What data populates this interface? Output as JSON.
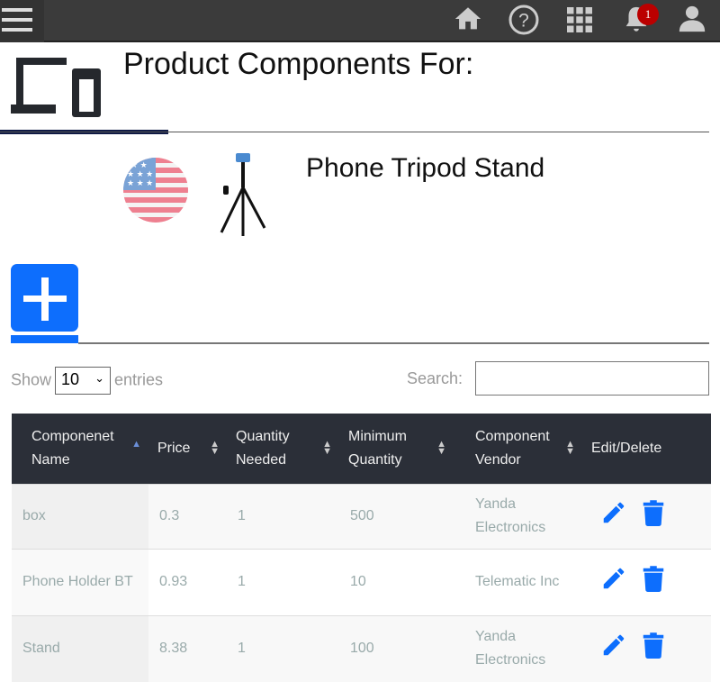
{
  "topbar": {
    "notification_count": "1",
    "icons": [
      "menu-icon",
      "home-icon",
      "help-icon",
      "apps-grid-icon",
      "bell-icon",
      "user-icon"
    ]
  },
  "header": {
    "title": "Product Components For:"
  },
  "product": {
    "name": "Phone Tripod Stand",
    "flag": "US"
  },
  "controls": {
    "show_label": "Show",
    "entries_value": "10",
    "entries_label": "entries",
    "search_label": "Search:",
    "search_value": ""
  },
  "table": {
    "columns": [
      "Componenet Name",
      "Price",
      "Quantity Needed",
      "Minimum Quantity",
      "Component Vendor",
      "Edit/Delete"
    ],
    "rows": [
      {
        "name": "box",
        "price": "0.3",
        "qty": "1",
        "min": "500",
        "vendor": "Yanda Electronics"
      },
      {
        "name": "Phone Holder BT",
        "price": "0.93",
        "qty": "1",
        "min": "10",
        "vendor": "Telematic Inc"
      },
      {
        "name": "Stand",
        "price": "8.38",
        "qty": "1",
        "min": "100",
        "vendor": "Yanda Electronics"
      }
    ]
  },
  "colors": {
    "accent": "#0d6efd",
    "topbar": "#3b3b3b",
    "table_header": "#2b2f38"
  }
}
